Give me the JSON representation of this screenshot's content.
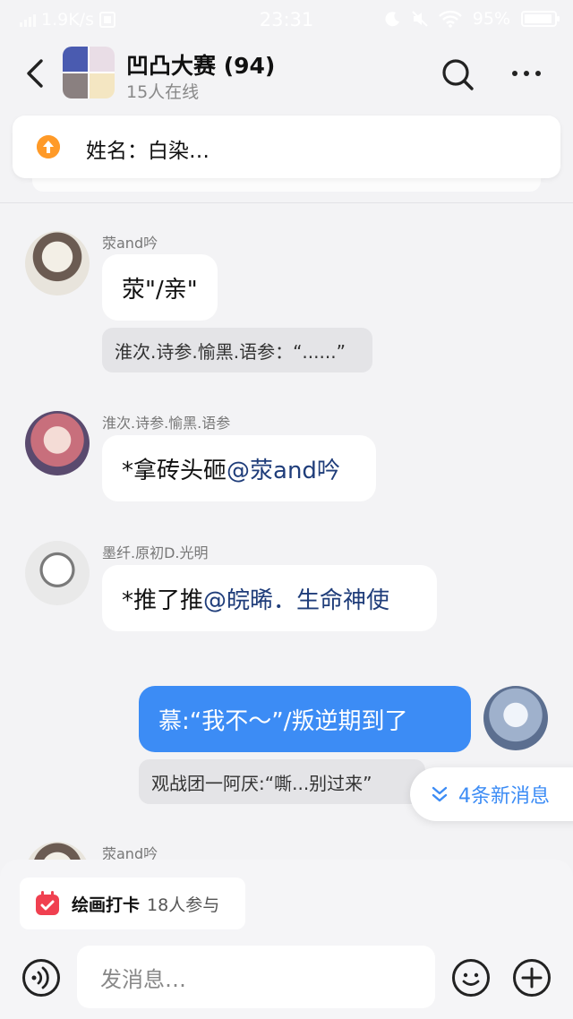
{
  "status": {
    "speed": "1.9K/s",
    "time": "23:31",
    "battery": "95%"
  },
  "header": {
    "title": "凹凸大赛 (94)",
    "subtitle": "15人在线"
  },
  "pinned": {
    "text": "姓名：白染…"
  },
  "messages": [
    {
      "sender": "荥and吟",
      "text": "荥\"/亲\"",
      "reply": "淮次.诗参.愉黑.语参：“......”"
    },
    {
      "sender": "淮次.诗参.愉黑.语参",
      "text_prefix": "*拿砖头砸",
      "mention": "@荥and吟"
    },
    {
      "sender": "墨纤.原初D.光明",
      "text_prefix": "*推了推",
      "mention": "@皖晞．生命神使"
    },
    {
      "text": "慕:“我不～”/叛逆期到了",
      "reply": "观战团一阿厌:“嘶...别过来”"
    },
    {
      "sender": "荥and吟"
    }
  ],
  "new_messages": {
    "label": "4条新消息"
  },
  "bottom": {
    "task_label": "绘画打卡",
    "task_count": "18人参与",
    "input_placeholder": "发消息…"
  },
  "colors": {
    "accent": "#3c8cf5",
    "mention": "#1f3d7a",
    "pin": "#ff9a28",
    "task": "#f04050"
  }
}
